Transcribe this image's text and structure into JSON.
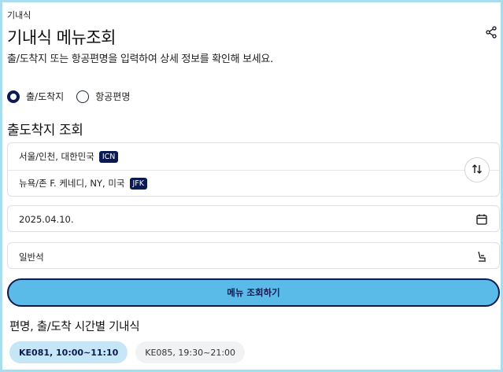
{
  "breadcrumb": "기내식",
  "page_title": "기내식 메뉴조회",
  "subtitle": "출/도착지 또는 항공편명을 입력하여 상세 정보를 확인해 보세요.",
  "search_mode": {
    "options": [
      {
        "label": "출/도착지",
        "selected": true
      },
      {
        "label": "항공편명",
        "selected": false
      }
    ]
  },
  "route_section_title": "출도착지 조회",
  "origin": {
    "label": "서울/인천, 대한민국",
    "code": "ICN"
  },
  "destination": {
    "label": "뉴욕/존 F. 케네디, NY, 미국",
    "code": "JFK"
  },
  "date": {
    "value": "2025.04.10."
  },
  "cabin": {
    "value": "일반석"
  },
  "cta_label": "메뉴 조회하기",
  "flights_title": "편명, 출/도착 시간별 기내식",
  "flights": [
    {
      "label": "KE081, 10:00~11:10",
      "active": true
    },
    {
      "label": "KE085, 19:30~21:00",
      "active": false
    }
  ],
  "colors": {
    "accent": "#0b1b52",
    "cta": "#5bbbe8",
    "chip_active": "#c5e6f6",
    "frame": "#a9dcec"
  },
  "icons": {
    "share": "share-icon",
    "swap": "swap-icon",
    "calendar": "calendar-icon",
    "seat": "seat-icon"
  }
}
